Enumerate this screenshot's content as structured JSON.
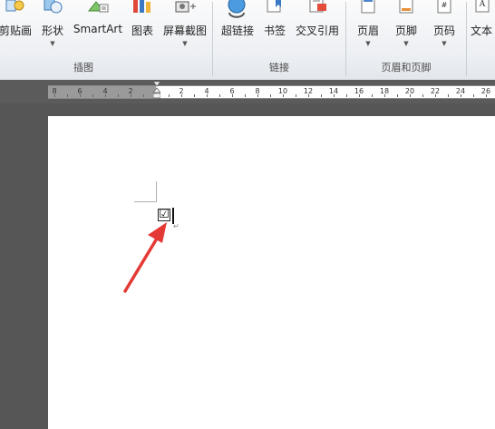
{
  "ribbon": {
    "groups": [
      {
        "label": "插图",
        "buttons": [
          {
            "label": "剪贴画",
            "icon": "clipart-icon",
            "dropdown": false
          },
          {
            "label": "形状",
            "icon": "shapes-icon",
            "dropdown": true
          },
          {
            "label": "SmartArt",
            "icon": "smartart-icon",
            "dropdown": false
          },
          {
            "label": "图表",
            "icon": "chart-icon",
            "dropdown": false
          },
          {
            "label": "屏幕截图",
            "icon": "screenshot-icon",
            "dropdown": true
          }
        ]
      },
      {
        "label": "链接",
        "buttons": [
          {
            "label": "超链接",
            "icon": "hyperlink-icon",
            "dropdown": false
          },
          {
            "label": "书签",
            "icon": "bookmark-icon",
            "dropdown": false
          },
          {
            "label": "交叉引用",
            "icon": "cross-reference-icon",
            "dropdown": false
          }
        ]
      },
      {
        "label": "页眉和页脚",
        "buttons": [
          {
            "label": "页眉",
            "icon": "header-icon",
            "dropdown": true
          },
          {
            "label": "页脚",
            "icon": "footer-icon",
            "dropdown": true
          },
          {
            "label": "页码",
            "icon": "page-number-icon",
            "dropdown": true
          }
        ]
      },
      {
        "label": "",
        "buttons": [
          {
            "label": "文本",
            "icon": "text-icon",
            "dropdown": false
          }
        ]
      }
    ]
  },
  "ruler": {
    "labels": [
      "8",
      "6",
      "4",
      "2",
      "2",
      "4",
      "6",
      "8",
      "10",
      "12",
      "14",
      "16",
      "18",
      "20",
      "22",
      "24",
      "26"
    ]
  },
  "document": {
    "checkbox_symbol": "☑",
    "paragraph_mark": "↵"
  },
  "annotation": {
    "arrow_color": "#e53935"
  }
}
